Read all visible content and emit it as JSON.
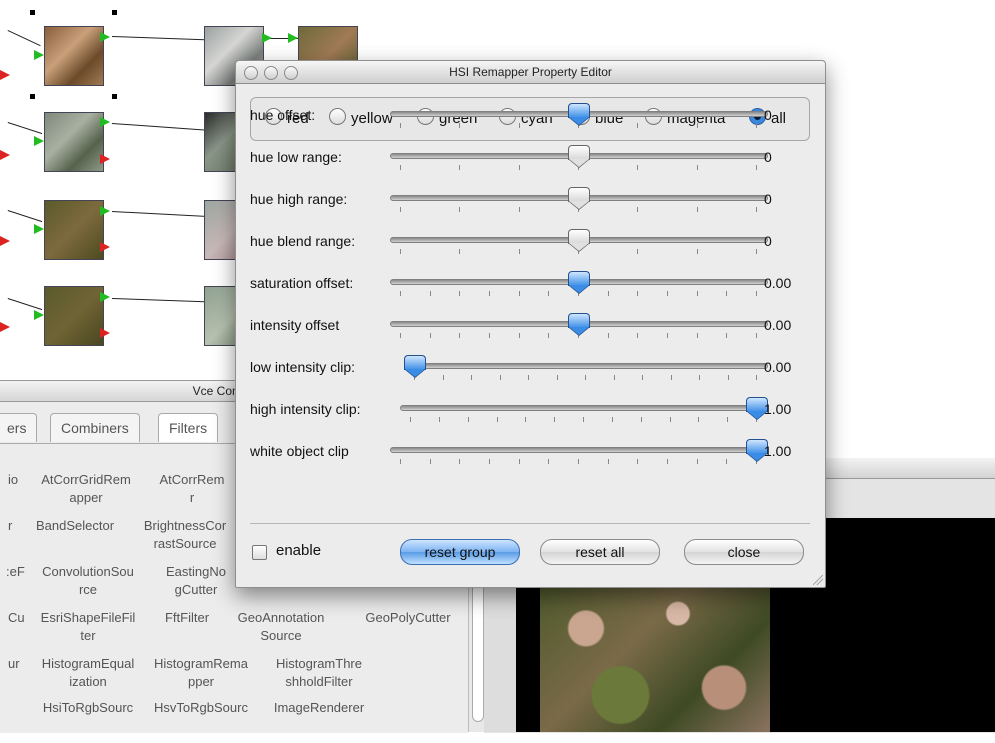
{
  "dialog": {
    "title": "HSI Remapper Property Editor",
    "channels": [
      {
        "label": "red",
        "selected": false
      },
      {
        "label": "yellow",
        "selected": false
      },
      {
        "label": "green",
        "selected": false
      },
      {
        "label": "cyan",
        "selected": false
      },
      {
        "label": "blue",
        "selected": false
      },
      {
        "label": "magenta",
        "selected": false
      },
      {
        "label": "all",
        "selected": true
      }
    ],
    "sliders": [
      {
        "label": "hue offset:",
        "value": "0",
        "fraction": 0.5
      },
      {
        "label": "hue low range:",
        "value": "0",
        "fraction": 0.5
      },
      {
        "label": "hue high range:",
        "value": "0",
        "fraction": 0.5
      },
      {
        "label": "hue blend range:",
        "value": "0",
        "fraction": 0.5
      },
      {
        "label": "saturation offset:",
        "value": "0.00",
        "fraction": 0.5
      },
      {
        "label": "intensity offset",
        "value": "0.00",
        "fraction": 0.5
      },
      {
        "label": "low intensity clip:",
        "value": "0.00",
        "fraction": 0.0
      },
      {
        "label": "high intensity clip:",
        "value": "1.00",
        "fraction": 1.0
      },
      {
        "label": "white object clip",
        "value": "1.00",
        "fraction": 1.0
      }
    ],
    "enable_label": "enable",
    "enable_checked": false,
    "buttons": {
      "reset_group": "reset group",
      "reset_all": "reset all",
      "close": "close"
    }
  },
  "vce": {
    "title": "Vce Componen",
    "tabs": [
      "ers",
      "Combiners",
      "Filters"
    ],
    "components": [
      [
        "io",
        "AtCorrGridRem\napper",
        "AtCorrRem\nr"
      ],
      [
        "r",
        "BandSelector",
        "BrightnessCor\nrastSource"
      ],
      [
        ":eF",
        "ConvolutionSou\nrce",
        "EastingNo\ngCutter"
      ],
      [
        "Cu",
        "EsriShapeFileFil\nter",
        "FftFilter",
        "GeoAnnotation\nSource",
        "GeoPolyCutter"
      ],
      [
        "ur",
        "HistogramEqual\nization",
        "HistogramRema\npper",
        "HistogramThre\nshholdFilter"
      ],
      [
        "",
        "HsiToRgbSourc",
        "HsvToRgbSourc",
        "ImageRenderer"
      ]
    ]
  },
  "colors": {
    "accent_blue": "#3a8ce6",
    "port_in": "#22bb22",
    "port_out": "#dd2222"
  }
}
